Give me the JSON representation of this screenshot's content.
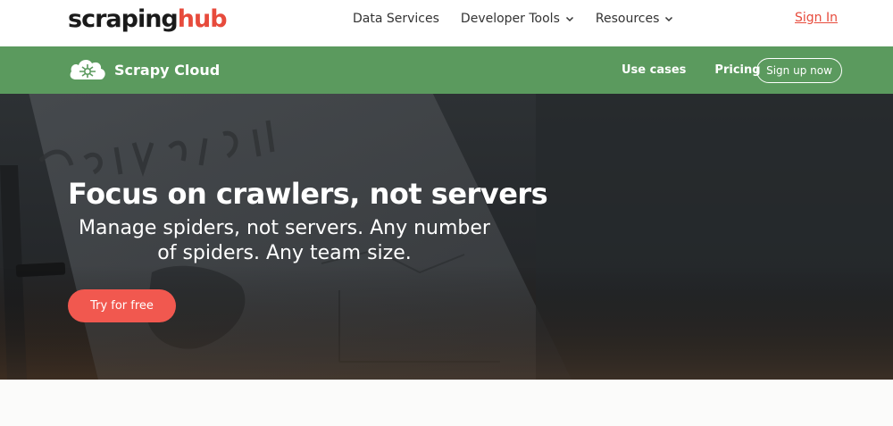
{
  "header": {
    "brand_part1": "scraping",
    "brand_part2": "hub",
    "nav": [
      {
        "label": "Data Services",
        "dropdown": false
      },
      {
        "label": "Developer Tools",
        "dropdown": true
      },
      {
        "label": "Resources",
        "dropdown": true
      }
    ],
    "sign_in": "Sign In"
  },
  "product_bar": {
    "name": "Scrapy Cloud",
    "icon": "scrapy-cloud-logo-icon",
    "links": [
      "Use cases",
      "Pricing"
    ],
    "signup": "Sign up now"
  },
  "hero": {
    "title": "Focus on crawlers, not servers",
    "subtitle": "Manage spiders, not servers. Any number of spiders. Any team size.",
    "cta": "Try for free"
  },
  "colors": {
    "accent": "#e74b3c",
    "green_bar": "#5b9a5e",
    "cta": "#f1584f",
    "hero_bg": "#2a2d30"
  }
}
